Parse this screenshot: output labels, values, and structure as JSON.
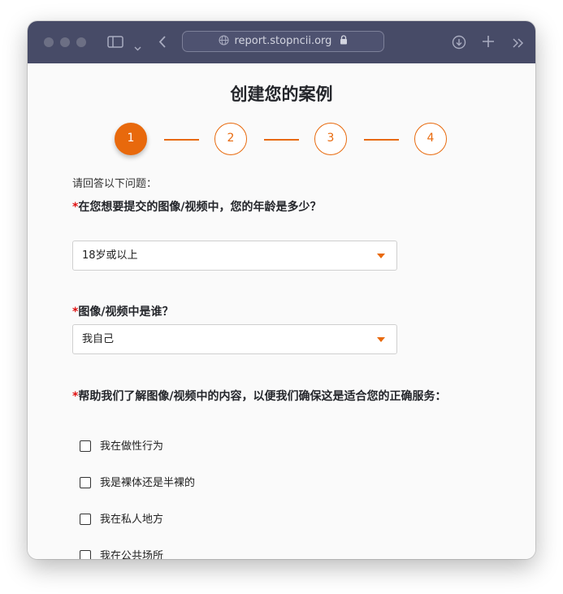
{
  "browser": {
    "url": "report.stopncii.org"
  },
  "page": {
    "title": "创建您的案例",
    "steps": [
      "1",
      "2",
      "3",
      "4"
    ],
    "prompt": "请回答以下问题：",
    "required_mark": "*",
    "q1": {
      "label": "在您想要提交的图像/视频中，您的年龄是多少？",
      "value": "18岁或以上"
    },
    "q2": {
      "label": "图像/视频中是谁？",
      "value": "我自己"
    },
    "q3": {
      "label": "帮助我们了解图像/视频中的内容，以便我们确保这是适合您的正确服务：",
      "options": [
        "我在做性行为",
        "我是裸体还是半裸的",
        "我在私人地方",
        "我在公共场所"
      ]
    }
  },
  "colors": {
    "accent": "#e8690c",
    "titlebar": "#474b67",
    "required": "#e01010"
  }
}
